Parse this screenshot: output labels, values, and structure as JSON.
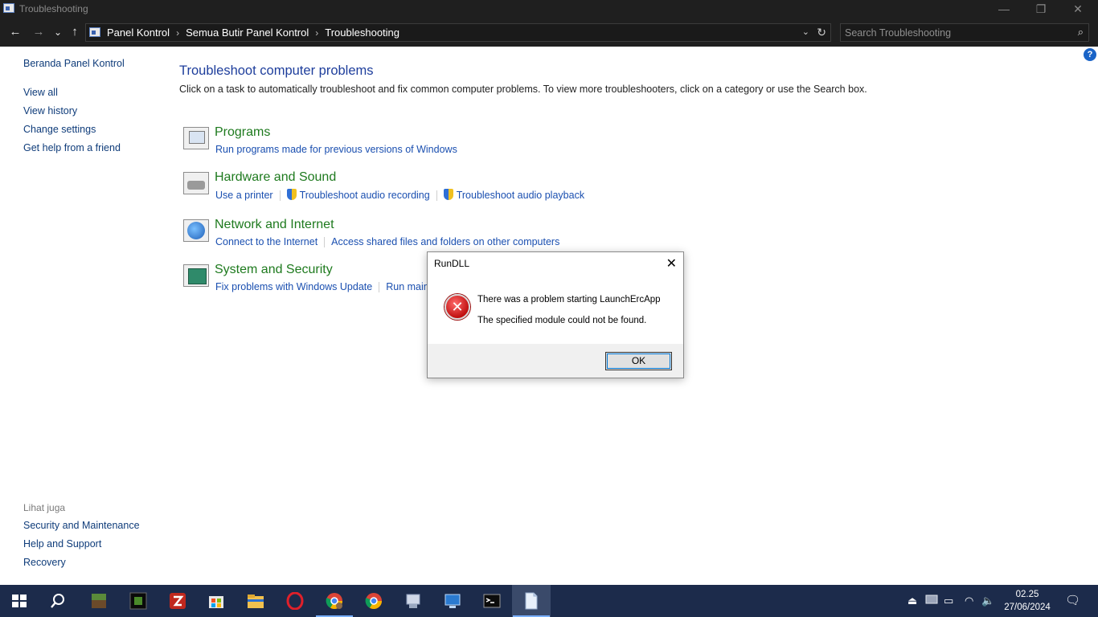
{
  "window": {
    "title": "Troubleshooting",
    "minimize_glyph": "—",
    "restore_glyph": "❐",
    "close_glyph": "✕"
  },
  "nav": {
    "back_glyph": "←",
    "forward_glyph": "→",
    "recent_glyph": "⌄",
    "up_glyph": "↑",
    "breadcrumb": [
      "Panel Kontrol",
      "Semua Butir Panel Kontrol",
      "Troubleshooting"
    ],
    "breadcrumb_sep": "›",
    "dropdown_glyph": "⌄",
    "refresh_glyph": "↻",
    "search_placeholder": "Search Troubleshooting",
    "search_glyph": "⌕"
  },
  "sidebar": {
    "home": "Beranda Panel Kontrol",
    "links": [
      "View all",
      "View history",
      "Change settings",
      "Get help from a friend"
    ],
    "see_also_label": "Lihat juga",
    "see_also": [
      "Security and Maintenance",
      "Help and Support",
      "Recovery"
    ]
  },
  "main": {
    "help_glyph": "?",
    "title": "Troubleshoot computer problems",
    "description": "Click on a task to automatically troubleshoot and fix common computer problems. To view more troubleshooters, click on a category or use the Search box.",
    "categories": [
      {
        "title": "Programs",
        "icon": "programs-icon",
        "links": [
          "Run programs made for previous versions of Windows"
        ]
      },
      {
        "title": "Hardware and Sound",
        "icon": "hardware-sound-icon",
        "links": [
          "Use a printer",
          "Troubleshoot audio recording",
          "Troubleshoot audio playback"
        ]
      },
      {
        "title": "Network and Internet",
        "icon": "network-icon",
        "links": [
          "Connect to the Internet",
          "Access shared files and folders on other computers"
        ]
      },
      {
        "title": "System and Security",
        "icon": "system-security-icon",
        "links": [
          "Fix problems with Windows Update",
          "Run mainte"
        ]
      }
    ]
  },
  "dialog": {
    "title": "RunDLL",
    "close_glyph": "✕",
    "error_glyph": "✕",
    "message_line1": "There was a problem starting LaunchErcApp",
    "message_line2": "The specified module could not be found.",
    "ok_label": "OK"
  },
  "taskbar": {
    "apps": [
      "start-icon",
      "search-icon",
      "minecraft-icon",
      "minecraft-server-icon",
      "filezilla-icon",
      "microsoft-store-icon",
      "file-explorer-icon",
      "opera-icon",
      "chrome-profile-icon",
      "chrome-icon",
      "control-panel-icon",
      "remote-desktop-icon",
      "terminal-icon",
      "notepad-icon"
    ],
    "tray": {
      "usb_glyph": "⏏",
      "battery_glyph": "▭",
      "wifi_glyph": "◠",
      "volume_glyph": "🔈",
      "notification_glyph": "🗨"
    },
    "time": "02.25",
    "date": "27/06/2024"
  },
  "colors": {
    "titlebar_bg": "#1f1f1f",
    "link": "#1a4fb0",
    "category_title": "#1e7a1e",
    "heading": "#1e3e9c",
    "taskbar_bg": "#1c2b4b"
  }
}
